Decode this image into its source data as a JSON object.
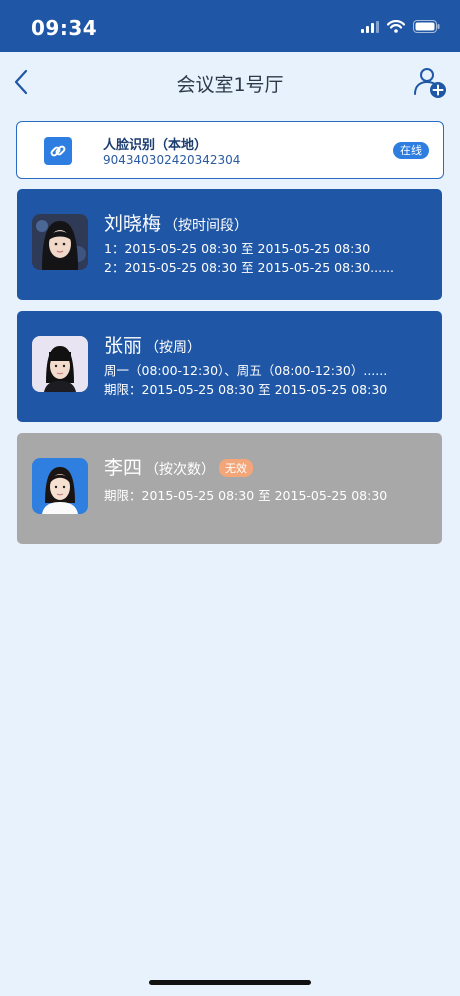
{
  "status_bar": {
    "time": "09:34"
  },
  "nav": {
    "title": "会议室1号厅"
  },
  "device": {
    "name": "人脸识别（本地）",
    "id": "904340302420342304",
    "status": "在线"
  },
  "users": [
    {
      "name": "刘晓梅",
      "mode": "（按时间段）",
      "lines": [
        "1：2015-05-25 08:30  至  2015-05-25 08:30",
        "2：2015-05-25 08:30  至  2015-05-25 08:30......"
      ],
      "state": "active"
    },
    {
      "name": "张丽",
      "mode": "（按周）",
      "lines": [
        "周一（08:00-12:30）、周五（08:00-12:30）......",
        "期限：2015-05-25 08:30  至  2015-05-25 08:30"
      ],
      "state": "active"
    },
    {
      "name": "李四",
      "mode": "（按次数）",
      "badge": "无效",
      "lines": [
        "期限：2015-05-25 08:30  至  2015-05-25 08:30"
      ],
      "state": "inactive"
    }
  ],
  "colors": {
    "primary": "#1f57a6",
    "background": "#e8f2fc",
    "inactive_card": "#a8a8a8",
    "invalid_badge": "#f3a67a",
    "online_badge": "#2e7de0"
  },
  "icons": {
    "back": "chevron-left-icon",
    "add_user": "add-user-icon",
    "device": "link-icon"
  }
}
